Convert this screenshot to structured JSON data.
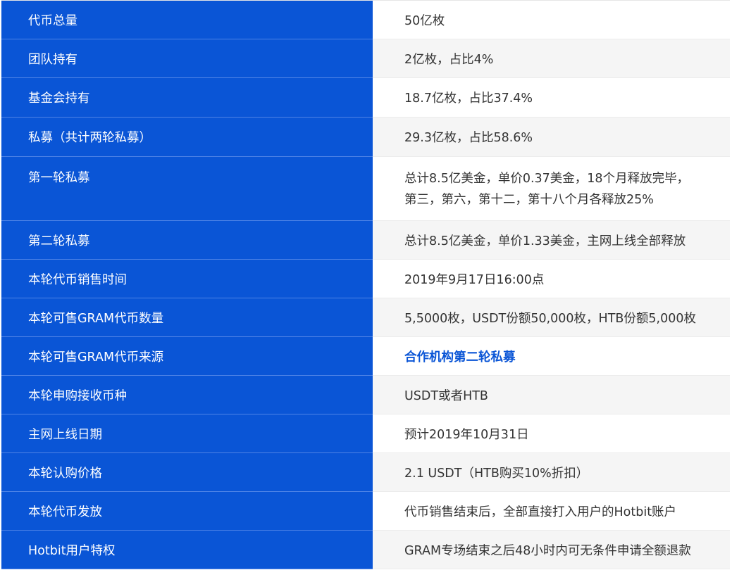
{
  "rows": [
    {
      "label": "代币总量",
      "value": "50亿枚"
    },
    {
      "label": "团队持有",
      "value": "2亿枚，占比4%"
    },
    {
      "label": "基金会持有",
      "value": "18.7亿枚，占比37.4%"
    },
    {
      "label": "私募（共计两轮私募）",
      "value": "29.3亿枚，占比58.6%"
    },
    {
      "label": "第一轮私募",
      "value_lines": [
        "总计8.5亿美金，单价0.37美金，18个月释放完毕，",
        "第三，第六，第十二，第十八个月各释放25%"
      ]
    },
    {
      "label": "第二轮私募",
      "value": "总计8.5亿美金，单价1.33美金，主网上线全部释放"
    },
    {
      "label": "本轮代币销售时间",
      "value": "2019年9月17日16:00点"
    },
    {
      "label": "本轮可售GRAM代币数量",
      "value": "5,5000枚，USDT份额50,000枚，HTB份额5,000枚"
    },
    {
      "label": "本轮可售GRAM代币来源",
      "value": "合作机构第二轮私募"
    },
    {
      "label": "本轮申购接收币种",
      "value": "USDT或者HTB"
    },
    {
      "label": "主网上线日期",
      "value": "预计2019年10月31日"
    },
    {
      "label": "本轮认购价格",
      "value": "2.1 USDT（HTB购买10%折扣）"
    },
    {
      "label": "本轮代币发放",
      "value": "代币销售结束后，全部直接打入用户的Hotbit账户"
    },
    {
      "label": "Hotbit用户特权",
      "value": "GRAM专场结束之后48小时内可无条件申请全额退款"
    }
  ],
  "colors": {
    "label_bg": "#0a55d6",
    "link": "#0a55d6",
    "alt_row_bg": "#f5f5f5"
  }
}
